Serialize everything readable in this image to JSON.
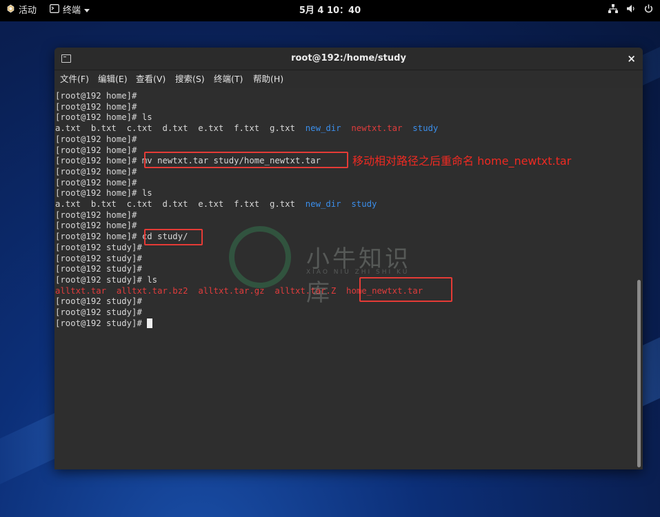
{
  "topbar": {
    "activities": "活动",
    "terminal_menu": "终端",
    "clock": "5月 4  10：40"
  },
  "window": {
    "title": "root@192:/home/study",
    "close": "×"
  },
  "menu": [
    "文件(F)",
    "编辑(E)",
    "查看(V)",
    "搜索(S)",
    "终端(T)",
    "帮助(H)"
  ],
  "terminal": {
    "lines": [
      [
        {
          "t": "[root@192 home]#"
        }
      ],
      [
        {
          "t": "[root@192 home]#"
        }
      ],
      [
        {
          "t": "[root@192 home]# ls"
        }
      ],
      [
        {
          "t": "a.txt  b.txt  c.txt  d.txt  e.txt  f.txt  g.txt  "
        },
        {
          "t": "new_dir",
          "c": "blue"
        },
        {
          "t": "  "
        },
        {
          "t": "newtxt.tar",
          "c": "red"
        },
        {
          "t": "  "
        },
        {
          "t": "study",
          "c": "blue"
        }
      ],
      [
        {
          "t": "[root@192 home]#"
        }
      ],
      [
        {
          "t": "[root@192 home]#"
        }
      ],
      [
        {
          "t": "[root@192 home]# mv newtxt.tar study/home_newtxt.tar"
        }
      ],
      [
        {
          "t": "[root@192 home]#"
        }
      ],
      [
        {
          "t": "[root@192 home]#"
        }
      ],
      [
        {
          "t": "[root@192 home]# ls"
        }
      ],
      [
        {
          "t": "a.txt  b.txt  c.txt  d.txt  e.txt  f.txt  g.txt  "
        },
        {
          "t": "new_dir",
          "c": "blue"
        },
        {
          "t": "  "
        },
        {
          "t": "study",
          "c": "blue"
        }
      ],
      [
        {
          "t": "[root@192 home]#"
        }
      ],
      [
        {
          "t": "[root@192 home]#"
        }
      ],
      [
        {
          "t": "[root@192 home]# cd study/"
        }
      ],
      [
        {
          "t": "[root@192 study]#"
        }
      ],
      [
        {
          "t": "[root@192 study]#"
        }
      ],
      [
        {
          "t": "[root@192 study]#"
        }
      ],
      [
        {
          "t": "[root@192 study]# ls"
        }
      ],
      [
        {
          "t": "alltxt.tar",
          "c": "red"
        },
        {
          "t": "  "
        },
        {
          "t": "alltxt.tar.bz2",
          "c": "red"
        },
        {
          "t": "  "
        },
        {
          "t": "alltxt.tar.gz",
          "c": "red"
        },
        {
          "t": "  "
        },
        {
          "t": "alltxt.tar.Z",
          "c": "red"
        },
        {
          "t": "  "
        },
        {
          "t": "home_newtxt.tar",
          "c": "red"
        }
      ],
      [
        {
          "t": "[root@192 study]#"
        }
      ],
      [
        {
          "t": "[root@192 study]#"
        }
      ],
      [
        {
          "t": "[root@192 study]# "
        }
      ]
    ]
  },
  "annotation": "移动相对路径之后重命名 home_newtxt.tar",
  "watermark": {
    "name": "小牛知识库",
    "sub": "XIAO NIU ZHI SHI KU"
  }
}
